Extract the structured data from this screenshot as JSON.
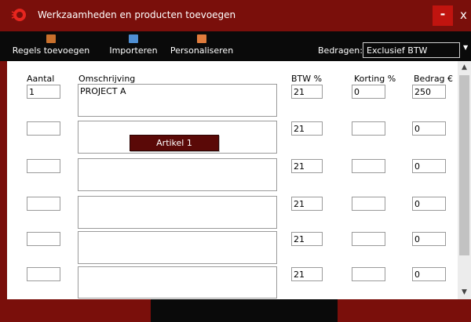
{
  "window": {
    "title": "Werkzaamheden en producten toevoegen",
    "minimize_label": "-",
    "close_label": "x"
  },
  "toolbar": {
    "regels_label": "Regels toevoegen",
    "importeren_label": "Importeren",
    "personaliseren_label": "Personaliseren",
    "bedragen_label": "Bedragen:",
    "bedragen_value": "Exclusief BTW"
  },
  "columns": {
    "aantal": "Aantal",
    "omschrijving": "Omschrijving",
    "btw": "BTW %",
    "korting": "Korting %",
    "bedrag": "Bedrag €"
  },
  "rows": [
    {
      "aantal": "1",
      "omschrijving": "PROJECT A",
      "btw": "21",
      "korting": "0",
      "bedrag": "250"
    },
    {
      "aantal": "",
      "omschrijving": "",
      "btw": "21",
      "korting": "",
      "bedrag": "0"
    },
    {
      "aantal": "",
      "omschrijving": "",
      "btw": "21",
      "korting": "",
      "bedrag": "0"
    },
    {
      "aantal": "",
      "omschrijving": "",
      "btw": "21",
      "korting": "",
      "bedrag": "0"
    },
    {
      "aantal": "",
      "omschrijving": "",
      "btw": "21",
      "korting": "",
      "bedrag": "0"
    },
    {
      "aantal": "",
      "omschrijving": "",
      "btw": "21",
      "korting": "",
      "bedrag": "0"
    }
  ],
  "popup": {
    "label": "Artikel 1"
  },
  "icons": {
    "app": "app-logo-icon",
    "regels": "add-rows-icon",
    "importeren": "import-icon",
    "personaliseren": "personalize-icon"
  },
  "colors": {
    "titlebar": "#7a0f0b",
    "toolbar": "#0a0a0a",
    "minimize": "#c0140f",
    "popup": "#5a0907"
  }
}
